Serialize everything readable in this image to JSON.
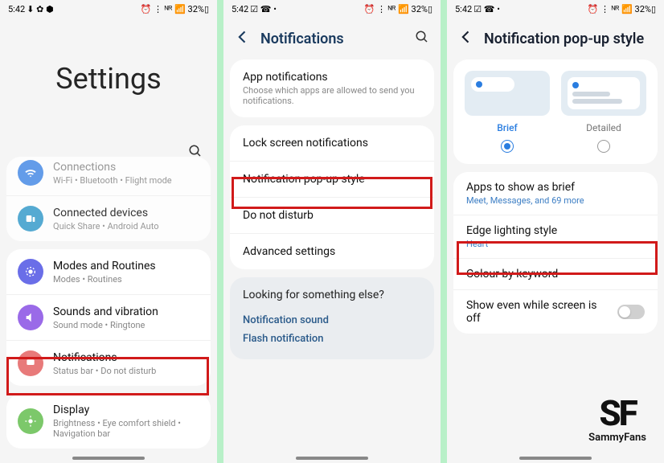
{
  "status": {
    "time": "5:42",
    "left_icons": "⬇ ✿ ⬢",
    "right_icons": "⏰ ⋮ ᴺᴿ 📶 32%▯",
    "left_icons2": "☑ ☎ •",
    "left_icons3": "☑ ☎ •"
  },
  "phone1": {
    "title": "Settings",
    "items": [
      {
        "title": "Connections",
        "sub": "Wi-Fi • Bluetooth • Flight mode",
        "color": "#4a8de8"
      },
      {
        "title": "Connected devices",
        "sub": "Quick Share • Android Auto",
        "color": "#3a9ecc"
      },
      {
        "title": "Modes and Routines",
        "sub": "Modes • Routines",
        "color": "#6a6ee8"
      },
      {
        "title": "Sounds and vibration",
        "sub": "Sound mode • Ringtone",
        "color": "#9a6ae8"
      },
      {
        "title": "Notifications",
        "sub": "Status bar • Do not disturb",
        "color": "#e87a7a"
      },
      {
        "title": "Display",
        "sub": "Brightness • Eye comfort shield • Navigation bar",
        "color": "#7cc86a"
      }
    ]
  },
  "phone2": {
    "title": "Notifications",
    "app_notif": {
      "title": "App notifications",
      "sub": "Choose which apps are allowed to send you notifications."
    },
    "items": [
      "Lock screen notifications",
      "Notification pop-up style",
      "Do not disturb",
      "Advanced settings"
    ],
    "looking": {
      "title": "Looking for something else?",
      "links": [
        "Notification sound",
        "Flash notification"
      ]
    }
  },
  "phone3": {
    "title": "Notification pop-up style",
    "styles": {
      "brief": "Brief",
      "detailed": "Detailed"
    },
    "items": [
      {
        "title": "Apps to show as brief",
        "sub": "Meet, Messages, and 69 more"
      },
      {
        "title": "Edge lighting style",
        "sub": "Heart"
      },
      {
        "title": "Colour by keyword",
        "sub": ""
      },
      {
        "title": "Show even while screen is off",
        "sub": ""
      }
    ],
    "logo": {
      "big": "SF",
      "small": "SammyFans"
    }
  }
}
